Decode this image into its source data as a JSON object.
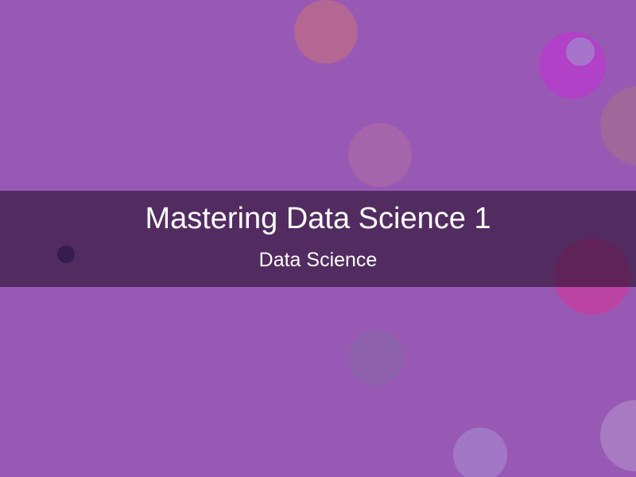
{
  "slide": {
    "title": "Mastering Data Science 1",
    "subtitle": "Data Science"
  },
  "colors": {
    "background": "#9859b5",
    "band": "#4b2a5a",
    "text": "#ffffff"
  }
}
